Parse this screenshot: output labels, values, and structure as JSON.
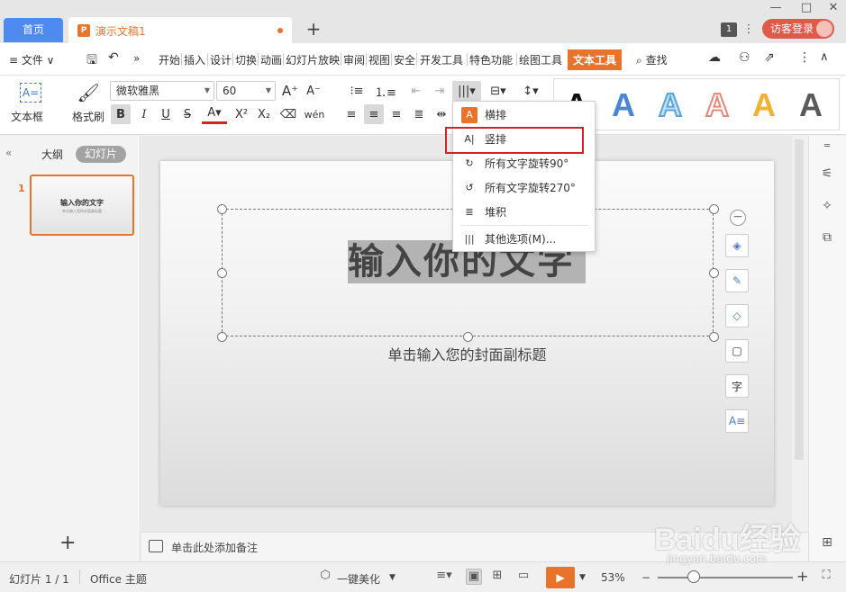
{
  "tabs": {
    "home": "首页",
    "doc": "演示文稿1",
    "new_tab": "+"
  },
  "window": {
    "badge": "1",
    "login": "访客登录"
  },
  "menu": {
    "file": "≡ 文件 ∨",
    "items": [
      "开始",
      "插入",
      "设计",
      "切换",
      "动画",
      "幻灯片放映",
      "审阅",
      "视图",
      "安全",
      "开发工具",
      "特色功能",
      "绘图工具",
      "文本工具"
    ],
    "active": "文本工具",
    "search": "查找"
  },
  "ribbon": {
    "textbox_label": "文本框",
    "format_painter_label": "格式刷",
    "font": "微软雅黑",
    "size": "60",
    "style_letters": [
      "A",
      "A",
      "A",
      "A",
      "A",
      "A"
    ]
  },
  "dropdown": {
    "items": [
      {
        "icon": "A",
        "label": "横排"
      },
      {
        "icon": "A|",
        "label": "竖排"
      },
      {
        "icon": "↻",
        "label": "所有文字旋转90°"
      },
      {
        "icon": "↺",
        "label": "所有文字旋转270°"
      },
      {
        "icon": "≣",
        "label": "堆积"
      },
      {
        "icon": "|||",
        "label": "其他选项(M)..."
      }
    ],
    "highlighted": "竖排"
  },
  "left_panel": {
    "tab_outline": "大纲",
    "tab_slides": "幻灯片",
    "slide_number": "1",
    "thumb_title": "输入你的文字",
    "thumb_subtitle": "单击输入您的封面副标题"
  },
  "slide": {
    "title": "输入你的文字",
    "subtitle": "单击输入您的封面副标题"
  },
  "notes": {
    "placeholder": "单击此处添加备注"
  },
  "status": {
    "slide_counter": "幻灯片 1 / 1",
    "theme": "Office 主题",
    "beautify": "一键美化",
    "zoom": "53%"
  },
  "watermark": {
    "brand": "Baidu经验",
    "url": "jingyan.baidu.com"
  },
  "colors": {
    "accent": "#e8742c",
    "tab_blue": "#4f8af0",
    "highlight_red": "#d4222a"
  }
}
